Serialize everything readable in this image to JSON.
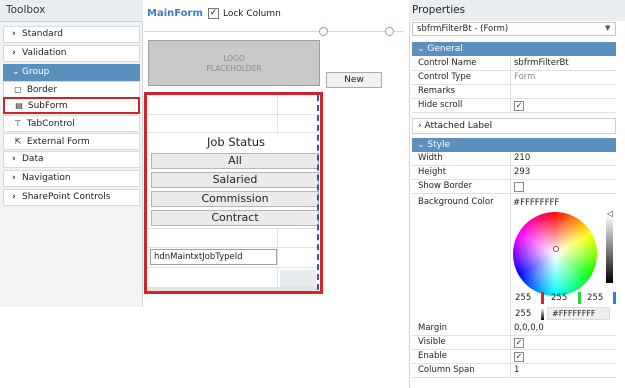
{
  "toolbox": {
    "title": "Toolbox",
    "pin_icon": "pin-icon",
    "items": [
      {
        "label": "Standard",
        "icon": "chevron-right-icon"
      },
      {
        "label": "Validation",
        "icon": "chevron-right-icon"
      },
      {
        "label": "Group",
        "icon": "chevron-down-icon"
      },
      {
        "label": "Border",
        "icon": "border-icon"
      },
      {
        "label": "SubForm",
        "icon": "subform-icon"
      },
      {
        "label": "TabControl",
        "icon": "tabcontrol-icon"
      },
      {
        "label": "External Form",
        "icon": "external-form-icon"
      },
      {
        "label": "Data",
        "icon": "chevron-right-icon"
      },
      {
        "label": "Navigation",
        "icon": "chevron-right-icon"
      },
      {
        "label": "SharePoint Controls",
        "icon": "chevron-right-icon"
      }
    ]
  },
  "designer": {
    "form_name": "MainForm",
    "lock_column_label": "Lock Column",
    "lock_column_checked": true,
    "logo_text": "LOGO\nPLACEHOLDER",
    "new_button": "New",
    "job_status_label": "Job Status",
    "options": [
      "All",
      "Salaried",
      "Commission",
      "Contract"
    ],
    "hidden_field": "hdnMaintxtJobTypeId"
  },
  "properties": {
    "title": "Properties",
    "selected_object": "sbfrmFilterBt - (Form)",
    "sections": {
      "general": "General",
      "attached_label": "Attached Label",
      "style": "Style"
    },
    "general": {
      "control_name_key": "Control Name",
      "control_name_value": "sbfrmFilterBt",
      "control_type_key": "Control Type",
      "control_type_value": "Form",
      "remarks_key": "Remarks",
      "hide_scroll_key": "Hide scroll",
      "hide_scroll_checked": true
    },
    "style": {
      "width_key": "Width",
      "width_value": "210",
      "height_key": "Height",
      "height_value": "293",
      "show_border_key": "Show Border",
      "show_border_checked": false,
      "bg_color_key": "Background Color",
      "bg_color_value": "#FFFFFFFF",
      "rgb": {
        "r": "255",
        "g": "255",
        "b": "255",
        "a": "255"
      },
      "hex_input": "#FFFFFFFF",
      "margin_key": "Margin",
      "margin_value": "0,0,0,0",
      "visible_key": "Visible",
      "visible_checked": true,
      "enable_key": "Enable",
      "enable_checked": true,
      "column_span_key": "Column Span",
      "column_span_value": "1"
    }
  },
  "colors": {
    "accent": "#5b8fbd",
    "highlight": "#d2232a",
    "form_name": "#3a7ec4"
  }
}
